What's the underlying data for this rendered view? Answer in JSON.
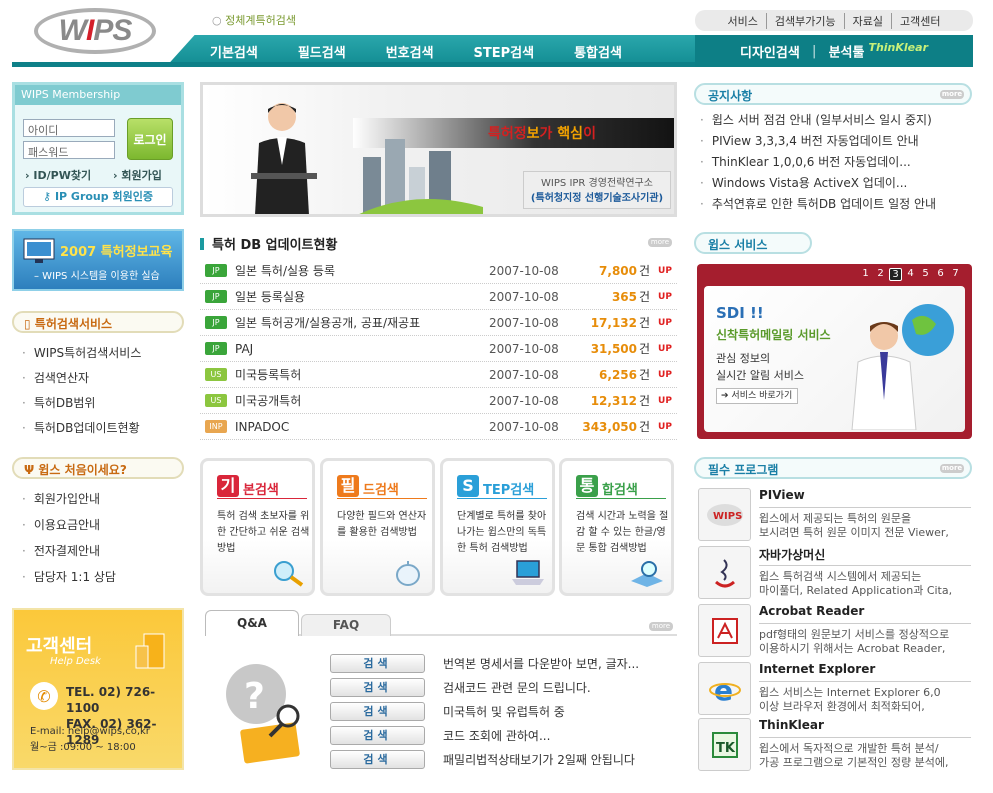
{
  "header": {
    "logo": {
      "pre": "W",
      "mid": "I",
      "post": "PS"
    },
    "slogan": "정체계특허검색",
    "util_links": [
      "서비스",
      "검색부가기능",
      "자료실",
      "고객센터"
    ],
    "nav": [
      "기본검색",
      "필드검색",
      "번호검색",
      "STEP검색",
      "통합검색"
    ],
    "nav_right": {
      "design": "디자인검색",
      "sep": "|",
      "analysis": "분석툴",
      "thinklear": "ThinKlear"
    }
  },
  "membership": {
    "title": "WIPS Membership",
    "id_placeholder": "아이디",
    "pw_placeholder": "패스워드",
    "login": "로그인",
    "find": "ID/PW찾기",
    "join": "회원가입",
    "ipgroup": "IP Group 회원인증"
  },
  "edu": {
    "title": "2007 특허정보교육",
    "sub": "– WIPS 시스템을 이용한 실습"
  },
  "search_service": {
    "title": "특허검색서비스",
    "items": [
      "WIPS특허검색서비스",
      "검색연산자",
      "특허DB범위",
      "특허DB업데이트현황"
    ]
  },
  "first_visit": {
    "title": "윕스 처음이세요?",
    "items": [
      "회원가입안내",
      "이용요금안내",
      "전자결제안내",
      "담당자 1:1 상담"
    ]
  },
  "help": {
    "title": "고객센터",
    "sub": "Help Desk",
    "tel": "TEL. 02) 726-1100",
    "fax": "FAX. 02) 362-1289",
    "email": "E-mail: help@wips,co,kr",
    "hours": "월~금 :09:00 ~ 18:00"
  },
  "banner": {
    "main_a": "특허정",
    "main_b": "보",
    "main_c": "가 ",
    "main_d": "핵심",
    "main_e": "이",
    "sub1": "WIPS IPR 경영전략연구소",
    "sub2": "(특허청지정 선행기술조사기관)"
  },
  "updates": {
    "title": "특허 DB 업데이트현황",
    "more": "more",
    "unit": "건",
    "up": "UP",
    "rows": [
      {
        "badge": "JP",
        "color": "#3aa53a",
        "title": "일본 특허/실용 등록",
        "date": "2007-10-08",
        "count": "7,800"
      },
      {
        "badge": "JP",
        "color": "#3aa53a",
        "title": "일본 등록실용",
        "date": "2007-10-08",
        "count": "365"
      },
      {
        "badge": "JP",
        "color": "#3aa53a",
        "title": "일본 특허공개/실용공개, 공표/재공표",
        "date": "2007-10-08",
        "count": "17,132"
      },
      {
        "badge": "JP",
        "color": "#3aa53a",
        "title": "PAJ",
        "date": "2007-10-08",
        "count": "31,500"
      },
      {
        "badge": "US",
        "color": "#8cc63f",
        "title": "미국등록특허",
        "date": "2007-10-08",
        "count": "6,256"
      },
      {
        "badge": "US",
        "color": "#8cc63f",
        "title": "미국공개특허",
        "date": "2007-10-08",
        "count": "12,312"
      },
      {
        "badge": "INP",
        "color": "#e8a650",
        "title": "INPADOC",
        "date": "2007-10-08",
        "count": "343,050"
      }
    ]
  },
  "search_boxes": [
    {
      "initial": "기",
      "rest": "본검색",
      "color": "#d9263a",
      "desc": "특허 검색 초보자를 위한 간단하고 쉬운 검색방법"
    },
    {
      "initial": "필",
      "rest": "드검색",
      "color": "#ee7a1c",
      "desc": "다양한 필드와 연산자를 활용한 검색방법"
    },
    {
      "initial": "S",
      "rest": "TEP검색",
      "color": "#2a9fd8",
      "desc": "단계별로 특허를 찾아나가는 윕스만의 독특한 특허 검색방법"
    },
    {
      "initial": "통",
      "rest": "합검색",
      "color": "#3aa04a",
      "desc": "검색 시간과 노력을 절감 할 수 있는 한글/영문 통합 검색방법"
    }
  ],
  "qna": {
    "tab_qa": "Q&A",
    "tab_faq": "FAQ",
    "more": "more",
    "btn": "검색",
    "items": [
      "번역본 명세서를 다운받아 보면, 글자...",
      "검새코드 관련 문의 드립니다.",
      "미국특허 및 유럽특허 중",
      "코드 조회에 관하여...",
      "패밀리법적상태보기가 2일째 안됩니다"
    ]
  },
  "notice": {
    "title": "공지사항",
    "more": "more",
    "items": [
      "윕스 서버 점검 안내 (일부서비스 일시 중지)",
      "PIView 3,3,3,4 버전 자동업데이트 안내",
      "ThinKlear 1,0,0,6 버전 자동업데이...",
      "Windows Vista용 ActiveX 업데이...",
      "추석연휴로 인한 특허DB 업데이트 일정 안내"
    ]
  },
  "wips_service": {
    "title": "윕스 서비스",
    "pages": [
      "1",
      "2",
      "3",
      "4",
      "5",
      "6",
      "7"
    ],
    "current": "3",
    "head": "SDI !!",
    "sub": "신착특허메일링 서비스",
    "desc1": "관심 정보의",
    "desc2": "실시간 알림 서비스",
    "btn": "서비스 바로가기"
  },
  "programs": {
    "title": "필수 프로그램",
    "more": "more",
    "items": [
      {
        "name": "PIView",
        "d1": "윕스에서 제공되는 특허의 원문을",
        "d2": "보시려면 특허 원문 이미지 전문 Viewer,"
      },
      {
        "name": "자바가상머신",
        "d1": "윕스 특허검색 시스템에서 제공되는",
        "d2": "마이풀더, Related Application과 Cita,"
      },
      {
        "name": "Acrobat Reader",
        "d1": "pdf형태의 원문보기 서비스를 정상적으로",
        "d2": "이용하시기 위해서는 Acrobat Reader,"
      },
      {
        "name": "Internet Explorer",
        "d1": "윕스 서비스는 Internet Explorer 6,0",
        "d2": "이상 브라우저 환경에서 최적화되어,"
      },
      {
        "name": "ThinKlear",
        "d1": "윕스에서 독자적으로 개발한 특허 분석/",
        "d2": "가공 프로그램으로 기본적인 정량 분석에,"
      }
    ]
  }
}
